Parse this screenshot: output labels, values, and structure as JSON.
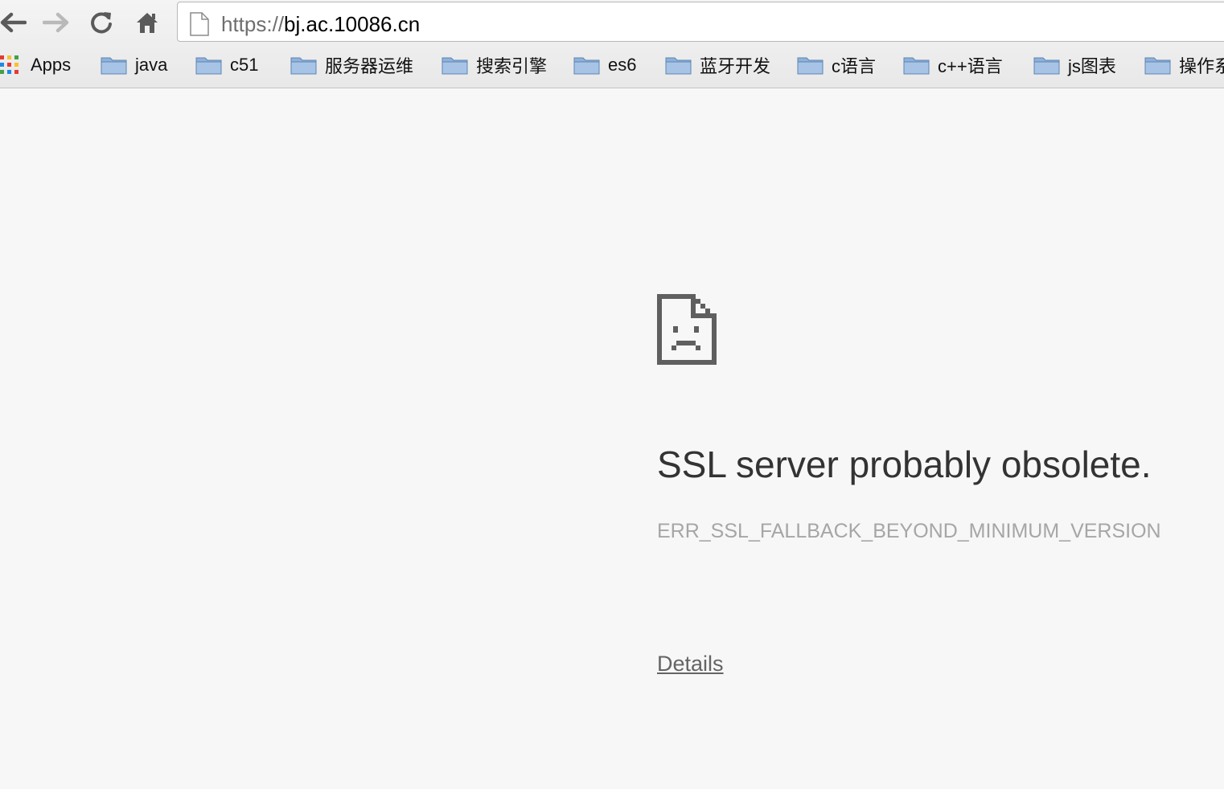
{
  "toolbar": {
    "back_icon": "arrow-left-icon",
    "forward_icon": "arrow-right-icon",
    "reload_icon": "reload-icon",
    "home_icon": "home-icon"
  },
  "omnibox": {
    "scheme": "https://",
    "host": "bj.ac.10086.cn",
    "page_icon": "page-icon"
  },
  "bookmarks": {
    "apps_label": "Apps",
    "items": [
      {
        "label": "java"
      },
      {
        "label": "c51"
      },
      {
        "label": "服务器运维"
      },
      {
        "label": "搜索引擎"
      },
      {
        "label": "es6"
      },
      {
        "label": "蓝牙开发"
      },
      {
        "label": "c语言"
      },
      {
        "label": "c++语言"
      },
      {
        "label": "js图表"
      },
      {
        "label": "操作系"
      }
    ]
  },
  "error_page": {
    "icon": "sad-page-icon",
    "title": "SSL server probably obsolete.",
    "code": "ERR_SSL_FALLBACK_BEYOND_MINIMUM_VERSION",
    "details_link": "Details"
  },
  "colors": {
    "page_background": "#f7f7f7",
    "title_text": "#333333",
    "code_text": "#a6a6a6",
    "link_text": "#646464",
    "folder_blue": "#8fb2d9"
  }
}
